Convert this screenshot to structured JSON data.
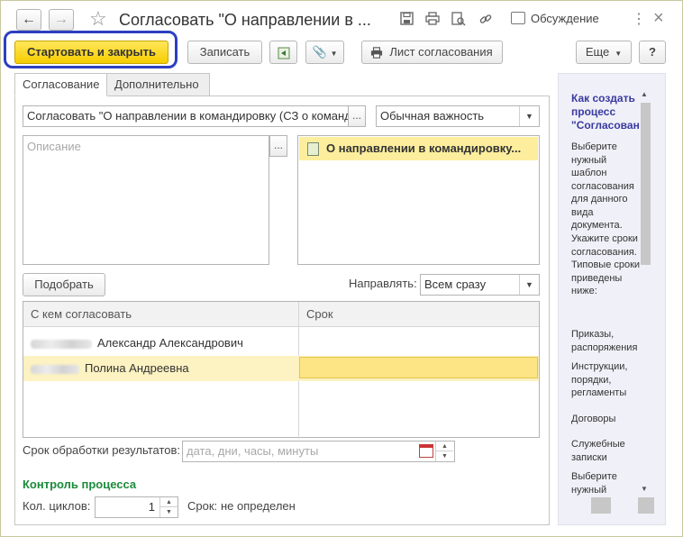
{
  "window": {
    "title": "Согласовать \"О направлении в ...",
    "discuss_label": "Обсуждение"
  },
  "toolbar": {
    "start_close_label": "Стартовать и закрыть",
    "save_label": "Записать",
    "approval_sheet_label": "Лист согласования",
    "more_label": "Еще",
    "help_label": "?"
  },
  "tabs": [
    {
      "label": "Согласование",
      "active": true
    },
    {
      "label": "Дополнительно",
      "active": false
    }
  ],
  "form": {
    "subject_value": "Согласовать \"О направлении в командировку (СЗ о команд",
    "importance_value": "Обычная важность",
    "description_placeholder": "Описание",
    "attachment_title": "О направлении в командировку...",
    "pick_label": "Подобрать",
    "direct_label": "Направлять:",
    "direct_value": "Всем сразу",
    "table": {
      "columns": [
        "С кем согласовать",
        "Срок"
      ],
      "rows": [
        {
          "name": "Александр Александрович",
          "deadline": ""
        },
        {
          "name": "Полина Андреевна",
          "deadline": ""
        }
      ]
    },
    "processing_label": "Срок обработки результатов:",
    "processing_placeholder": "дата, дни, часы, минуты",
    "control_title": "Контроль процесса",
    "cycles_label": "Кол. циклов:",
    "cycles_value": "1",
    "term_label": "Срок:",
    "term_value": "не определен"
  },
  "help": {
    "title_line1": "Как создать",
    "title_line2": "процесс",
    "title_line3": "\"Согласован",
    "paragraphs": [
      "Выберите нужный шаблон согласования для данного вида документа.",
      "Укажите сроки согласования. Типовые сроки приведены ниже:",
      "Приказы, распоряжения",
      "Инструкции, порядки, регламенты",
      "Договоры",
      "Служебные записки",
      "Выберите нужный"
    ]
  }
}
